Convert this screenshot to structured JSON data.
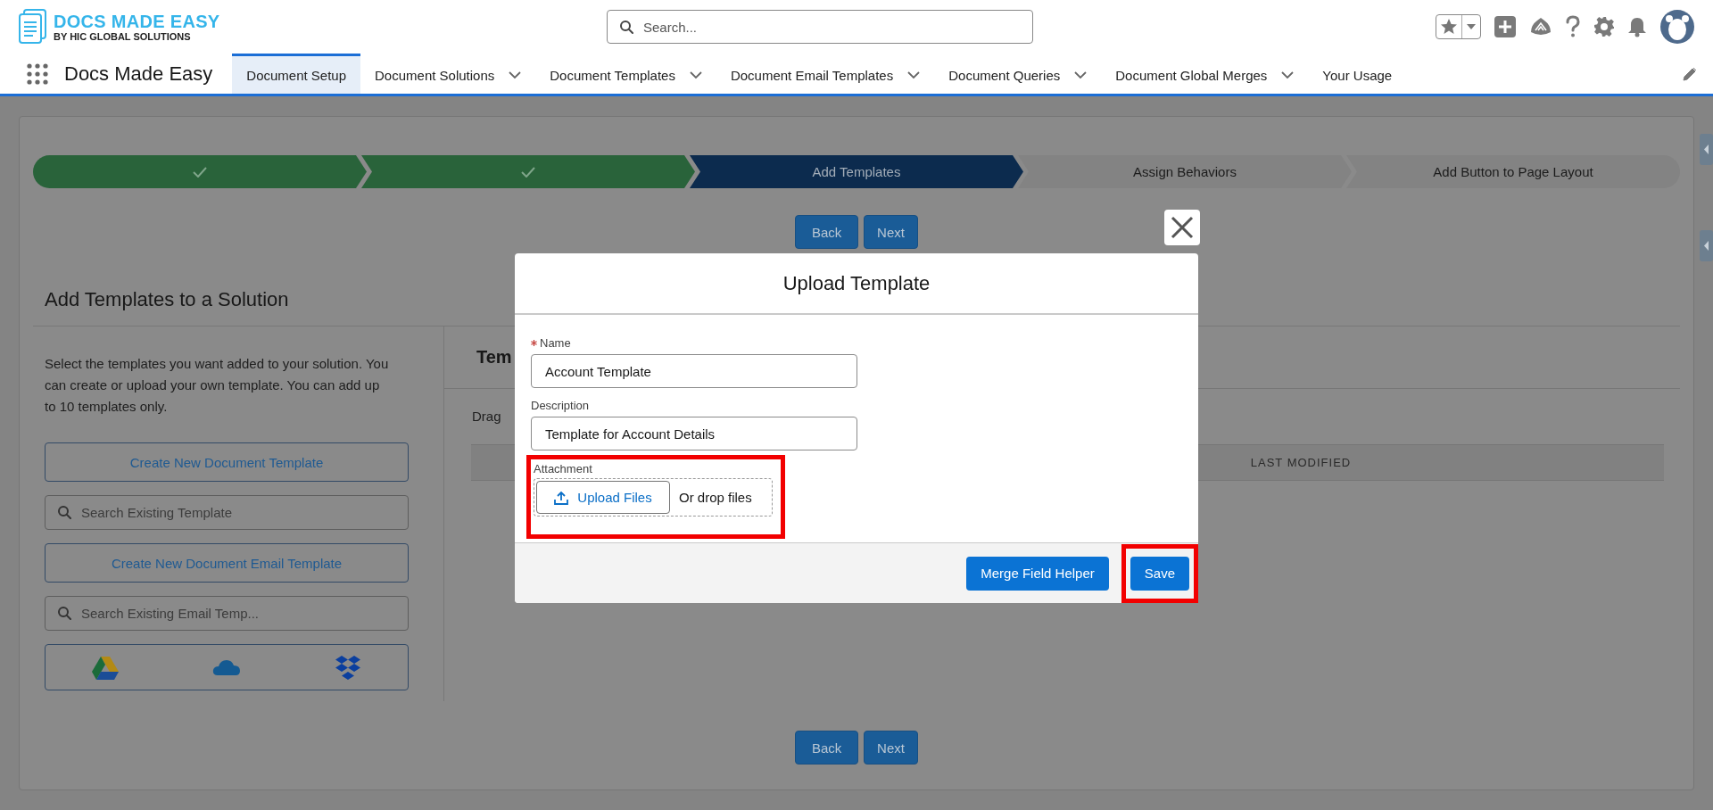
{
  "header": {
    "logo": {
      "title": "DOCS MADE EASY",
      "subtitle": "BY HIC GLOBAL SOLUTIONS"
    },
    "search": {
      "placeholder": "Search..."
    }
  },
  "nav": {
    "app_name": "Docs Made Easy",
    "tabs": [
      {
        "label": "Document Setup",
        "has_menu": false,
        "selected": true
      },
      {
        "label": "Document Solutions",
        "has_menu": true,
        "selected": false
      },
      {
        "label": "Document Templates",
        "has_menu": true,
        "selected": false
      },
      {
        "label": "Document Email Templates",
        "has_menu": true,
        "selected": false
      },
      {
        "label": "Document Queries",
        "has_menu": true,
        "selected": false
      },
      {
        "label": "Document Global Merges",
        "has_menu": true,
        "selected": false
      },
      {
        "label": "Your Usage",
        "has_menu": false,
        "selected": false
      }
    ]
  },
  "progress": {
    "steps": [
      {
        "complete": true,
        "current": false
      },
      {
        "complete": true,
        "current": false
      },
      {
        "label": "Add Templates",
        "complete": false,
        "current": true
      },
      {
        "label": "Assign Behaviors",
        "complete": false,
        "current": false
      },
      {
        "label": "Add Button to Page Layout",
        "complete": false,
        "current": false
      }
    ]
  },
  "top_buttons": [
    "Back",
    "Next"
  ],
  "left_panel": {
    "title": "Add Templates to a Solution",
    "intro": "Select the templates you want added to your solution. You can create or upload your own template. You can add up to 10 templates only.",
    "create_template_button": "Create New Document Template",
    "template_search": {
      "placeholder": "Search Existing Template"
    },
    "create_email_button": "Create New Document Email Template",
    "email_search": {
      "placeholder": "Search Existing Email Temp..."
    }
  },
  "right_panel": {
    "heading": "Tem",
    "hint": "Drag",
    "table": {
      "columns": [
        "LAST MODIFIED"
      ]
    }
  },
  "bottom_buttons": [
    "Back",
    "Next"
  ],
  "modal": {
    "title": "Upload Template",
    "fields": [
      {
        "label": "Name",
        "required": true,
        "value": "Account Template"
      },
      {
        "label": "Description",
        "required": false,
        "value": "Template for Account Details"
      }
    ],
    "attachment": {
      "label": "Attachment",
      "upload_button": "Upload Files",
      "drop_text": "Or drop files",
      "highlighted": true
    },
    "buttons": [
      {
        "label": "Merge Field Helper",
        "highlighted": false
      },
      {
        "label": "Save",
        "highlighted": true
      }
    ]
  }
}
